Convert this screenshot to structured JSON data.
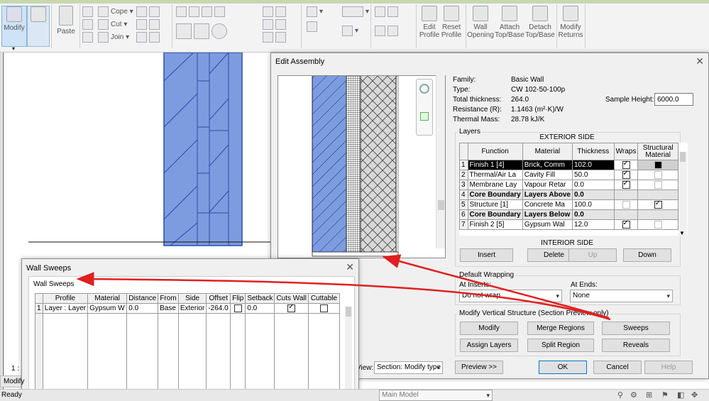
{
  "ribbon": {
    "modify_label": "Modify",
    "paste_label": "Paste",
    "cope_label": "Cope",
    "cut_label": "Cut",
    "join_label": "Join",
    "buttons": [
      {
        "line1": "Edit",
        "line2": "Profile"
      },
      {
        "line1": "Reset",
        "line2": "Profile"
      },
      {
        "line1": "Wall",
        "line2": "Opening"
      },
      {
        "line1": "Attach",
        "line2": "Top/Base"
      },
      {
        "line1": "Detach",
        "line2": "Top/Base"
      },
      {
        "line1": "Modify",
        "line2": "Returns"
      }
    ]
  },
  "edit_assembly": {
    "title": "Edit Assembly",
    "properties": {
      "family_label": "Family:",
      "family_value": "Basic Wall",
      "type_label": "Type:",
      "type_value": "CW 102-50-100p",
      "thickness_label": "Total thickness:",
      "thickness_value": "264.0",
      "resistance_label": "Resistance (R):",
      "resistance_value": "1.1463 (m²·K)/W",
      "mass_label": "Thermal Mass:",
      "mass_value": "28.78 kJ/K",
      "sample_height_label": "Sample Height:",
      "sample_height_value": "6000.0"
    },
    "layers_title": "Layers",
    "exterior_side": "EXTERIOR SIDE",
    "interior_side": "INTERIOR SIDE",
    "columns": [
      "Function",
      "Material",
      "Thickness",
      "Wraps",
      "Structural Material"
    ],
    "rows": [
      {
        "num": "1",
        "function": "Finish 1 [4]",
        "material": "Brick, Comm",
        "thickness": "102.0",
        "wraps": true,
        "structural": false
      },
      {
        "num": "2",
        "function": "Thermal/Air La",
        "material": "Cavity Fill",
        "thickness": "50.0",
        "wraps": true,
        "structural": false
      },
      {
        "num": "3",
        "function": "Membrane Lay",
        "material": "Vapour Retar",
        "thickness": "0.0",
        "wraps": true,
        "structural": false
      },
      {
        "num": "4",
        "function": "Core Boundary",
        "material": "Layers Above",
        "thickness": "0.0",
        "wraps": null,
        "structural": null
      },
      {
        "num": "5",
        "function": "Structure [1]",
        "material": "Concrete Ma",
        "thickness": "100.0",
        "wraps": false,
        "structural": true
      },
      {
        "num": "6",
        "function": "Core Boundary",
        "material": "Layers Below",
        "thickness": "0.0",
        "wraps": null,
        "structural": null
      },
      {
        "num": "7",
        "function": "Finish 2 [5]",
        "material": "Gypsum Wal",
        "thickness": "12.0",
        "wraps": true,
        "structural": false
      }
    ],
    "insert_label": "Insert",
    "delete_label": "Delete",
    "up_label": "Up",
    "down_label": "Down",
    "default_wrapping_title": "Default Wrapping",
    "at_inserts_label": "At Inserts:",
    "at_inserts_value": "Do not wrap",
    "at_ends_label": "At Ends:",
    "at_ends_value": "None",
    "modify_vertical_title": "Modify Vertical Structure (Section Preview only)",
    "modify_label": "Modify",
    "merge_regions_label": "Merge Regions",
    "sweeps_label": "Sweeps",
    "assign_layers_label": "Assign Layers",
    "split_region_label": "Split Region",
    "reveals_label": "Reveals",
    "view_label": "View:",
    "view_value": "Section: Modify type",
    "preview_label": "Preview >>",
    "ok_label": "OK",
    "cancel_label": "Cancel",
    "help_label": "Help"
  },
  "wall_sweeps": {
    "title": "Wall Sweeps",
    "group_title": "Wall Sweeps",
    "columns": [
      "Profile",
      "Material",
      "Distance",
      "From",
      "Side",
      "Offset",
      "Flip",
      "Setback",
      "Cuts Wall",
      "Cuttable"
    ],
    "rows": [
      {
        "num": "1",
        "profile": "Layer : Layer",
        "material": "Gypsum W",
        "distance": "0.0",
        "from": "Base",
        "side": "Exterior",
        "offset": "-264.0",
        "flip": false,
        "setback": "0.0",
        "cuts_wall": true,
        "cuttable": false
      }
    ]
  },
  "status": {
    "ready": "Ready",
    "scale": "1 :",
    "modify_tab": "Modify",
    "model": "Main Model"
  },
  "colors": {
    "arrow": "#e02020",
    "wall_blue": "#7d9ce0",
    "selected_row": "#000000"
  }
}
